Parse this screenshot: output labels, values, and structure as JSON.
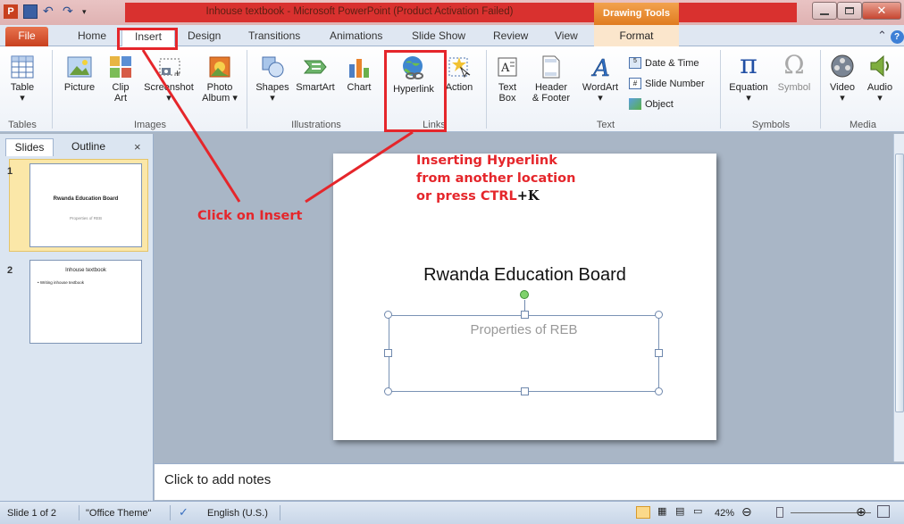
{
  "window": {
    "title": "Inhouse textbook  -  Microsoft PowerPoint (Product Activation Failed)",
    "contextual_group": "Drawing Tools"
  },
  "tabs": {
    "file": "File",
    "home": "Home",
    "insert": "Insert",
    "design": "Design",
    "transitions": "Transitions",
    "animations": "Animations",
    "slideshow": "Slide Show",
    "review": "Review",
    "view": "View",
    "format": "Format"
  },
  "ribbon": {
    "table": "Table",
    "picture": "Picture",
    "clipart_1": "Clip",
    "clipart_2": "Art",
    "screenshot": "Screenshot",
    "photoalbum_1": "Photo",
    "photoalbum_2": "Album",
    "shapes": "Shapes",
    "smartart": "SmartArt",
    "chart": "Chart",
    "hyperlink": "Hyperlink",
    "action": "Action",
    "textbox_1": "Text",
    "textbox_2": "Box",
    "header_1": "Header",
    "header_2": "& Footer",
    "wordart": "WordArt",
    "datetime": "Date & Time",
    "slidenumber": "Slide Number",
    "object": "Object",
    "equation": "Equation",
    "symbol": "Symbol",
    "video": "Video",
    "audio": "Audio",
    "groups": {
      "tables": "Tables",
      "images": "Images",
      "illustrations": "Illustrations",
      "links": "Links",
      "text": "Text",
      "symbols": "Symbols",
      "media": "Media"
    }
  },
  "left_pane": {
    "tab_slides": "Slides",
    "tab_outline": "Outline",
    "close": "×",
    "slides": [
      {
        "num": "1",
        "title": "Rwanda Education Board",
        "subtitle": "Properties of REB"
      },
      {
        "num": "2",
        "title": "Inhouse textbook",
        "bullet": "• Writing inhouse textbook"
      }
    ]
  },
  "slide": {
    "title": "Rwanda Education Board",
    "subtitle": "Properties of REB"
  },
  "annotations": {
    "click_insert": "Click on Insert",
    "hyper_line1": "Inserting Hyperlink",
    "hyper_line2": "from another location",
    "hyper_line3a": "or press CTRL",
    "hyper_line3b": "+K"
  },
  "notes": {
    "placeholder": "Click to add notes"
  },
  "status": {
    "slide_info": "Slide 1 of 2",
    "theme": "\"Office Theme\"",
    "language": "English (U.S.)",
    "zoom": "42%"
  },
  "colors": {
    "annotation_red": "#e5262b",
    "file_tab": "#c8401f",
    "drawing_tools": "#e07c20"
  }
}
